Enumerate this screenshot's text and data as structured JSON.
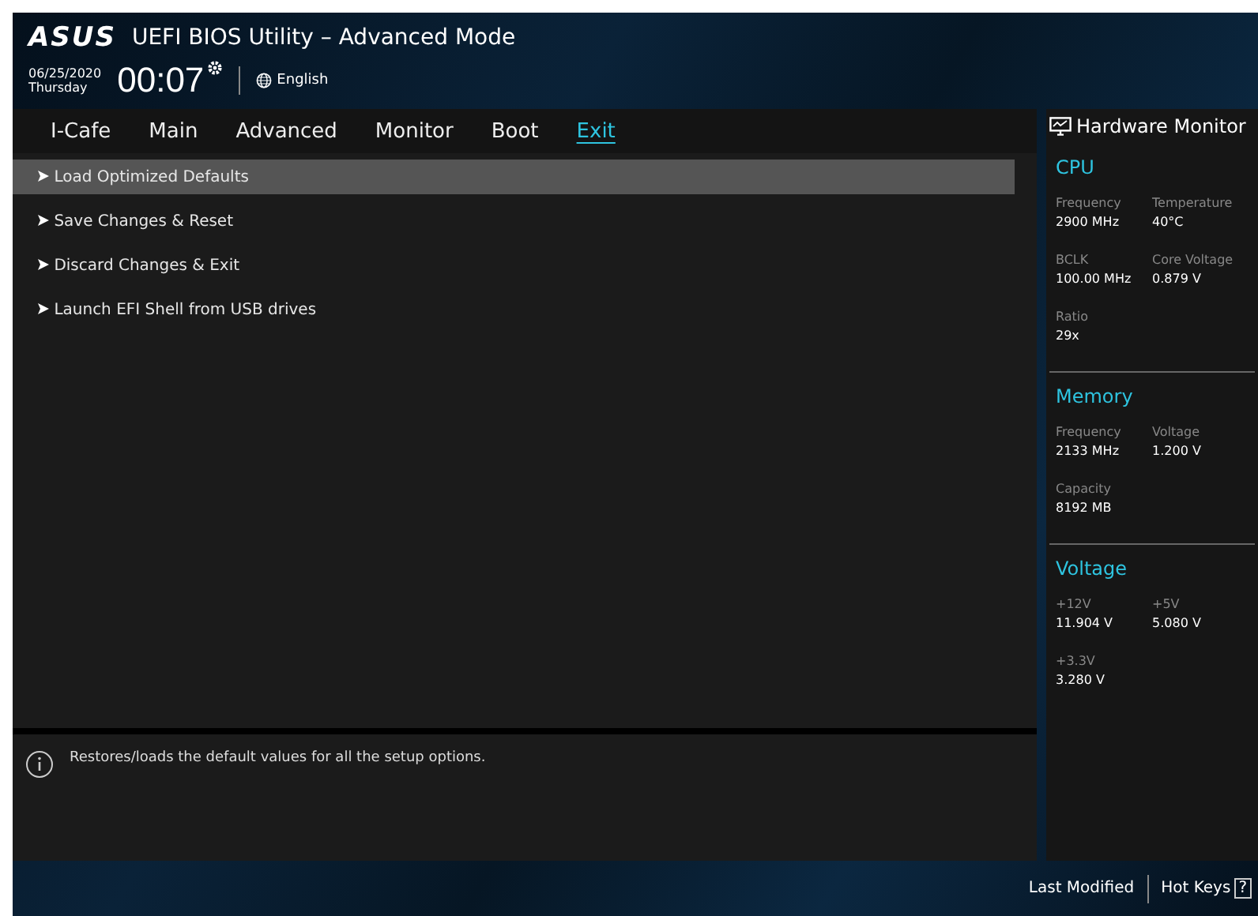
{
  "header": {
    "logo": "ASUS",
    "title": "UEFI BIOS Utility – Advanced Mode",
    "date": "06/25/2020",
    "day": "Thursday",
    "time": "00:07",
    "language": "English"
  },
  "tabs": [
    {
      "label": "I-Cafe",
      "selected": false
    },
    {
      "label": "Main",
      "selected": false
    },
    {
      "label": "Advanced",
      "selected": false
    },
    {
      "label": "Monitor",
      "selected": false
    },
    {
      "label": "Boot",
      "selected": false
    },
    {
      "label": "Exit",
      "selected": true
    }
  ],
  "menu_items": [
    {
      "label": "Load Optimized Defaults",
      "selected": true
    },
    {
      "label": "Save Changes & Reset",
      "selected": false
    },
    {
      "label": "Discard Changes & Exit",
      "selected": false
    },
    {
      "label": "Launch EFI Shell from USB drives",
      "selected": false
    }
  ],
  "help_text": "Restores/loads the default values for all the setup options.",
  "hardware_monitor": {
    "title": "Hardware Monitor",
    "sections": [
      {
        "title": "CPU",
        "readings": [
          {
            "label": "Frequency",
            "value": "2900 MHz"
          },
          {
            "label": "Temperature",
            "value": "40°C"
          },
          {
            "label": "BCLK",
            "value": "100.00 MHz"
          },
          {
            "label": "Core Voltage",
            "value": "0.879 V"
          },
          {
            "label": "Ratio",
            "value": "29x"
          }
        ]
      },
      {
        "title": "Memory",
        "readings": [
          {
            "label": "Frequency",
            "value": "2133 MHz"
          },
          {
            "label": "Voltage",
            "value": "1.200 V"
          },
          {
            "label": "Capacity",
            "value": "8192 MB"
          }
        ]
      },
      {
        "title": "Voltage",
        "readings": [
          {
            "label": "+12V",
            "value": "11.904 V"
          },
          {
            "label": "+5V",
            "value": "5.080 V"
          },
          {
            "label": "+3.3V",
            "value": "3.280 V"
          }
        ]
      }
    ]
  },
  "footer": {
    "last_modified": "Last Modified",
    "hot_keys": "Hot Keys",
    "hot_keys_key": "?"
  }
}
